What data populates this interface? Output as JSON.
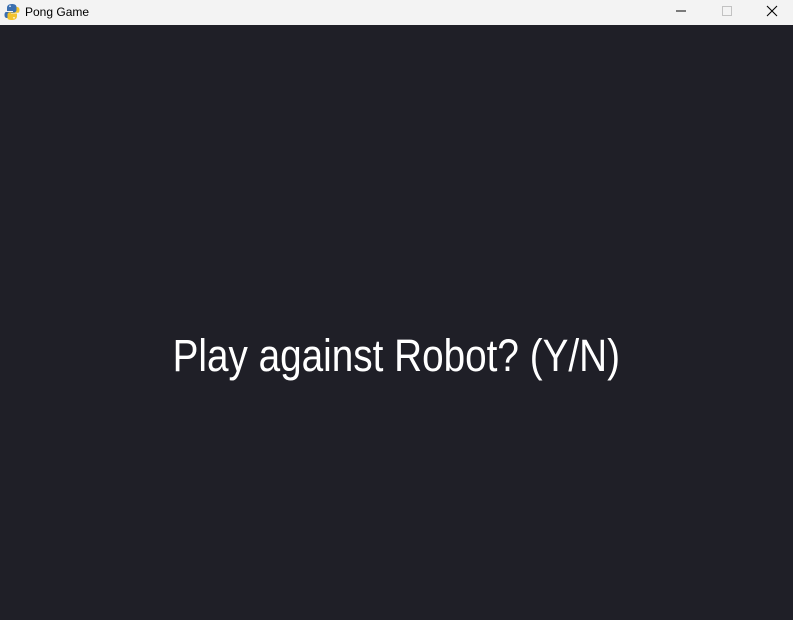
{
  "window": {
    "title": "Pong Game",
    "app_icon": "python-snake-icon",
    "controls": {
      "minimize_icon": "minimize-icon",
      "maximize_icon": "maximize-icon",
      "close_icon": "close-icon"
    }
  },
  "game": {
    "prompt": "Play against Robot? (Y/N)",
    "background_color": "#1f1f27",
    "text_color": "#ffffff"
  }
}
